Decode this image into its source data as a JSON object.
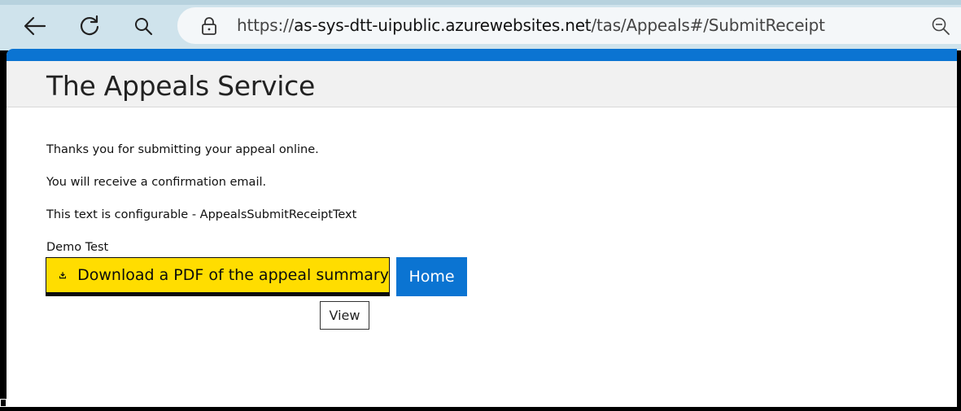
{
  "browser": {
    "url_prefix": "https://",
    "url_host": "as-sys-dtt-uipublic.azurewebsites.net",
    "url_path": "/tas/Appeals#/SubmitReceipt",
    "icons": {
      "back": "back-arrow-icon",
      "refresh": "refresh-icon",
      "search": "search-icon",
      "site_info": "lock-icon",
      "zoom": "zoom-out-icon"
    }
  },
  "header": {
    "title": "The Appeals Service",
    "accent_color": "#0b74d2"
  },
  "main": {
    "paragraphs": [
      "Thanks you for submitting your appeal online.",
      "You will receive a confirmation email.",
      "This text is configurable - AppealsSubmitReceiptText",
      "Demo Test"
    ],
    "download_button": {
      "label": "Download a PDF of the appeal summary",
      "icon": "download-icon",
      "color": "#ffdd00"
    },
    "home_button": {
      "label": "Home",
      "color": "#0b74d2"
    },
    "tooltip": {
      "label": "View"
    }
  }
}
